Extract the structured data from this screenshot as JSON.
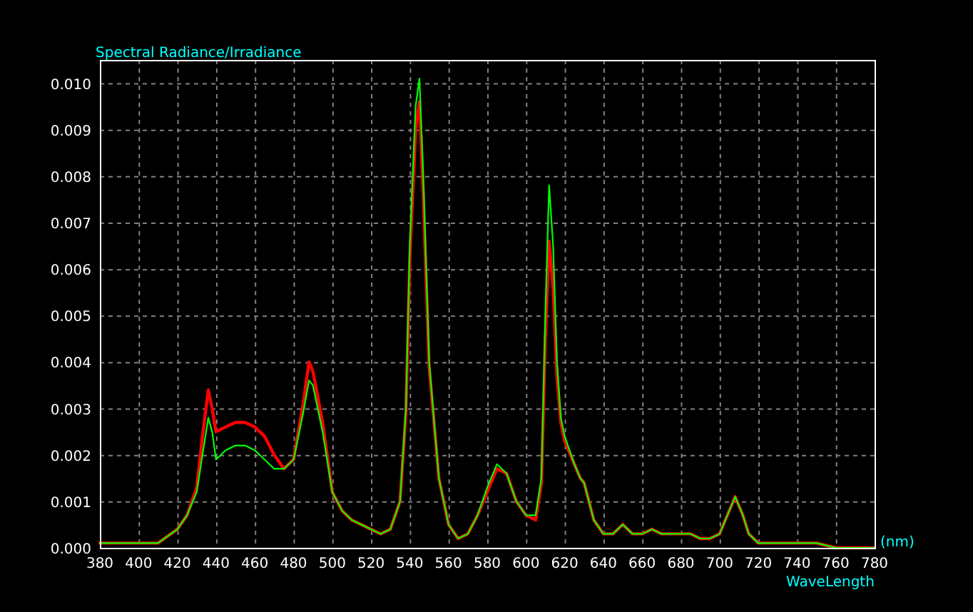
{
  "plot": {
    "unit_label": "(nm)",
    "chart_data": {
      "type": "line",
      "title": "Spectral Radiance/Irradiance",
      "xlabel": "WaveLength",
      "grid": true,
      "x": [
        380,
        390,
        400,
        410,
        420,
        425,
        430,
        433,
        436,
        438,
        440,
        445,
        450,
        455,
        460,
        465,
        470,
        475,
        480,
        485,
        488,
        490,
        495,
        500,
        505,
        510,
        515,
        520,
        525,
        530,
        535,
        538,
        540,
        543,
        545,
        547,
        550,
        555,
        560,
        565,
        570,
        575,
        580,
        585,
        590,
        595,
        600,
        605,
        608,
        610,
        612,
        614,
        616,
        618,
        620,
        625,
        628,
        630,
        635,
        640,
        645,
        650,
        655,
        660,
        665,
        670,
        675,
        680,
        685,
        690,
        695,
        700,
        705,
        708,
        712,
        715,
        720,
        730,
        740,
        750,
        760,
        770,
        780
      ],
      "series": [
        {
          "color": "#ff0000",
          "values": [
            0.0001,
            0.0001,
            0.0001,
            0.0001,
            0.0004,
            0.0007,
            0.0013,
            0.0024,
            0.0034,
            0.003,
            0.0025,
            0.0026,
            0.0027,
            0.0027,
            0.0026,
            0.0024,
            0.002,
            0.0017,
            0.0019,
            0.0031,
            0.004,
            0.0038,
            0.0027,
            0.0012,
            0.0008,
            0.0006,
            0.0005,
            0.0004,
            0.0003,
            0.0004,
            0.001,
            0.0029,
            0.0062,
            0.009,
            0.0096,
            0.0076,
            0.0039,
            0.0015,
            0.0005,
            0.0002,
            0.0003,
            0.0007,
            0.0012,
            0.0017,
            0.0016,
            0.001,
            0.0007,
            0.0006,
            0.0014,
            0.0045,
            0.0066,
            0.0056,
            0.0037,
            0.0027,
            0.0023,
            0.0018,
            0.0015,
            0.0014,
            0.0006,
            0.0003,
            0.0003,
            0.0005,
            0.0003,
            0.0003,
            0.0004,
            0.0003,
            0.0003,
            0.0003,
            0.0003,
            0.0002,
            0.0002,
            0.0003,
            0.0008,
            0.0011,
            0.0007,
            0.0003,
            0.0001,
            0.0001,
            0.0001,
            0.0001,
            0,
            0,
            0
          ]
        },
        {
          "color": "#00ff00",
          "values": [
            0.0001,
            0.0001,
            0.0001,
            0.0001,
            0.0004,
            0.0007,
            0.0012,
            0.002,
            0.0028,
            0.0025,
            0.0019,
            0.0021,
            0.0022,
            0.0022,
            0.0021,
            0.0019,
            0.0017,
            0.0017,
            0.0019,
            0.0029,
            0.0036,
            0.0035,
            0.0025,
            0.0012,
            0.0008,
            0.0006,
            0.0005,
            0.0004,
            0.0003,
            0.0004,
            0.001,
            0.003,
            0.0065,
            0.0095,
            0.0101,
            0.008,
            0.004,
            0.0015,
            0.0005,
            0.0002,
            0.0003,
            0.0007,
            0.0013,
            0.0018,
            0.0016,
            0.001,
            0.0007,
            0.0007,
            0.0015,
            0.005,
            0.0078,
            0.0065,
            0.004,
            0.0028,
            0.0024,
            0.0018,
            0.0015,
            0.0014,
            0.0006,
            0.0003,
            0.0003,
            0.0005,
            0.0003,
            0.0003,
            0.0004,
            0.0003,
            0.0003,
            0.0003,
            0.0003,
            0.0002,
            0.0002,
            0.0003,
            0.0008,
            0.0011,
            0.0007,
            0.0003,
            0.0001,
            0.0001,
            0.0001,
            0.0001,
            0,
            0,
            0
          ]
        }
      ],
      "xlim": [
        380,
        780
      ],
      "ylim": [
        0,
        0.0105
      ],
      "xticks": [
        380,
        400,
        420,
        440,
        460,
        480,
        500,
        520,
        540,
        560,
        580,
        600,
        620,
        640,
        660,
        680,
        700,
        720,
        740,
        760,
        780
      ],
      "yticks": [
        {
          "value": 0,
          "label": "0.000"
        },
        {
          "value": 0.001,
          "label": "0.001"
        },
        {
          "value": 0.002,
          "label": "0.002"
        },
        {
          "value": 0.003,
          "label": "0.003"
        },
        {
          "value": 0.004,
          "label": "0.004"
        },
        {
          "value": 0.005,
          "label": "0.005"
        },
        {
          "value": 0.006,
          "label": "0.006"
        },
        {
          "value": 0.007,
          "label": "0.007"
        },
        {
          "value": 0.008,
          "label": "0.008"
        },
        {
          "value": 0.009,
          "label": "0.009"
        },
        {
          "value": 0.01,
          "label": "0.010"
        }
      ]
    }
  }
}
